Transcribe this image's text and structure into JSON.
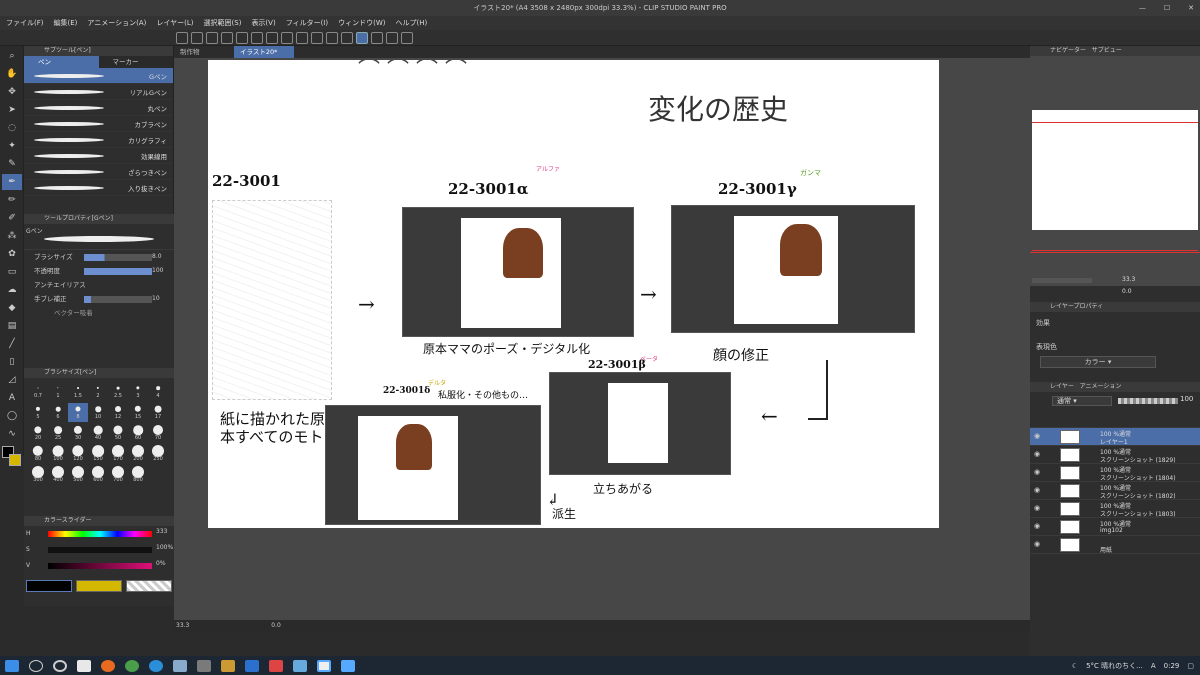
{
  "window": {
    "title": "イラスト20* (A4 3508 x 2480px 300dpi 33.3%)  - CLIP STUDIO PAINT PRO",
    "controls": [
      "—",
      "☐",
      "✕"
    ]
  },
  "menu": [
    "ファイル(F)",
    "編集(E)",
    "アニメーション(A)",
    "レイヤー(L)",
    "選択範囲(S)",
    "表示(V)",
    "フィルター(I)",
    "ウィンドウ(W)",
    "ヘルプ(H)"
  ],
  "doc_tabs": [
    "制作物",
    "イラスト20*"
  ],
  "subtool": {
    "header": "サブツール[ペン]",
    "tabs": [
      "ペン",
      "マーカー"
    ],
    "brushes": [
      "Gペン",
      "リアルGペン",
      "丸ペン",
      "カブラペン",
      "カリグラフィ",
      "効果線用",
      "ざらつきペン",
      "入り抜きペン"
    ]
  },
  "toolprop": {
    "header": "ツールプロパティ[Gペン]",
    "brush_name": "Gペン",
    "rows": [
      {
        "label": "ブラシサイズ",
        "value": "8.0",
        "fill": 0.3
      },
      {
        "label": "不透明度",
        "value": "100",
        "fill": 1.0
      },
      {
        "label": "アンチエイリアス",
        "value": "",
        "fill": 0
      },
      {
        "label": "手ブレ補正",
        "value": "10",
        "fill": 0.1
      },
      {
        "label": "ベクター吸着",
        "value": "",
        "fill": 0
      }
    ]
  },
  "brushsize": {
    "header": "ブラシサイズ[ペン]",
    "sizes": [
      "0.7",
      "1",
      "1.5",
      "2",
      "2.5",
      "3",
      "4",
      "5",
      "6",
      "8",
      "10",
      "12",
      "15",
      "17",
      "20",
      "25",
      "30",
      "40",
      "50",
      "60",
      "70",
      "80",
      "100",
      "120",
      "150",
      "170",
      "200",
      "250",
      "300",
      "400",
      "500",
      "600",
      "700",
      "800"
    ],
    "selected": "8"
  },
  "colorslider": {
    "header": "カラースライダー",
    "rows": [
      {
        "label": "H",
        "value": "333"
      },
      {
        "label": "S",
        "value": "100%"
      },
      {
        "label": "V",
        "value": "0%"
      }
    ],
    "swatches": [
      "#000000",
      "#d4b800"
    ]
  },
  "canvas_notes": {
    "title": "変化の歴史",
    "main_code": "22-3001",
    "alpha": {
      "code": "22-3001α",
      "tag": "アルファ",
      "caption": "原本ママのポーズ・デジタル化"
    },
    "gamma": {
      "code": "22-3001γ",
      "tag": "ガンマ",
      "caption": "顔の修正"
    },
    "beta": {
      "code": "22-3001β",
      "tag": "ベータ",
      "caption": "立ちあがる"
    },
    "delta": {
      "code": "22-3001δ",
      "tag": "デルタ",
      "caption": "私服化・その他もの…"
    },
    "original": "紙に描かれた原本すべてのモト",
    "derive": "派生"
  },
  "navigator": {
    "header": "ナビゲーター",
    "tab2": "サブビュー",
    "zoom": "33.3",
    "angle": "0.0"
  },
  "layerprop": {
    "header": "レイヤープロパティ",
    "effect": "効果",
    "color_label": "表現色",
    "color_value": "カラー"
  },
  "layers_panel": {
    "header": "レイヤー",
    "tab2": "アニメーション",
    "blend": "通常",
    "opacity": "100",
    "items": [
      {
        "mode": "100 %通常",
        "name": "レイヤー1",
        "selected": true
      },
      {
        "mode": "100 %通常",
        "name": "スクリーンショット (1829)",
        "selected": false
      },
      {
        "mode": "100 %通常",
        "name": "スクリーンショット (1804)",
        "selected": false
      },
      {
        "mode": "100 %通常",
        "name": "スクリーンショット (1802)",
        "selected": false
      },
      {
        "mode": "100 %通常",
        "name": "スクリーンショット (1803)",
        "selected": false
      },
      {
        "mode": "100 %通常",
        "name": "img102",
        "selected": false
      },
      {
        "mode": "",
        "name": "用紙",
        "selected": false
      }
    ]
  },
  "status": {
    "zoom": "33.3",
    "angle": "0.0"
  },
  "taskbar": {
    "weather": "5°C 晴れのちく...",
    "ime": "A",
    "time": "0:29"
  }
}
